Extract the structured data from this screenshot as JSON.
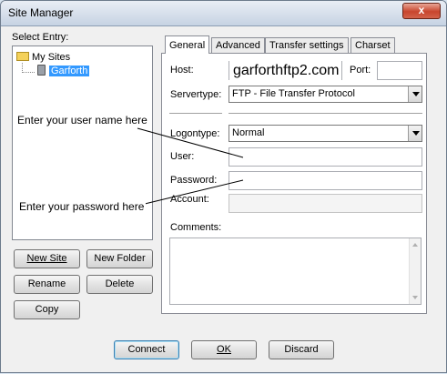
{
  "window": {
    "title": "Site Manager",
    "close_glyph": "x"
  },
  "left": {
    "select_entry_label": "Select Entry:",
    "tree": [
      {
        "label": "My Sites",
        "icon": "folder-icon"
      },
      {
        "label": "Garforth",
        "icon": "server-icon",
        "selected": true
      }
    ],
    "buttons": {
      "new_site": "New Site",
      "new_folder": "New Folder",
      "rename": "Rename",
      "delete": "Delete",
      "copy": "Copy"
    }
  },
  "tabs": [
    "General",
    "Advanced",
    "Transfer settings",
    "Charset"
  ],
  "general": {
    "host_label": "Host:",
    "host_value": "garforthftp2.com",
    "port_label": "Port:",
    "port_value": "",
    "servertype_label": "Servertype:",
    "servertype_value": "FTP - File Transfer Protocol",
    "logontype_label": "Logontype:",
    "logontype_value": "Normal",
    "user_label": "User:",
    "user_value": "",
    "password_label": "Password:",
    "password_value": "",
    "account_label": "Account:",
    "account_value": "",
    "comments_label": "Comments:"
  },
  "annotations": {
    "user_hint": "Enter your user name here",
    "password_hint": "Enter your password here"
  },
  "footer": {
    "connect": "Connect",
    "ok": "OK",
    "cancel": "Discard"
  },
  "colors": {
    "selection": "#3399ff",
    "close_button": "#c8452d"
  }
}
